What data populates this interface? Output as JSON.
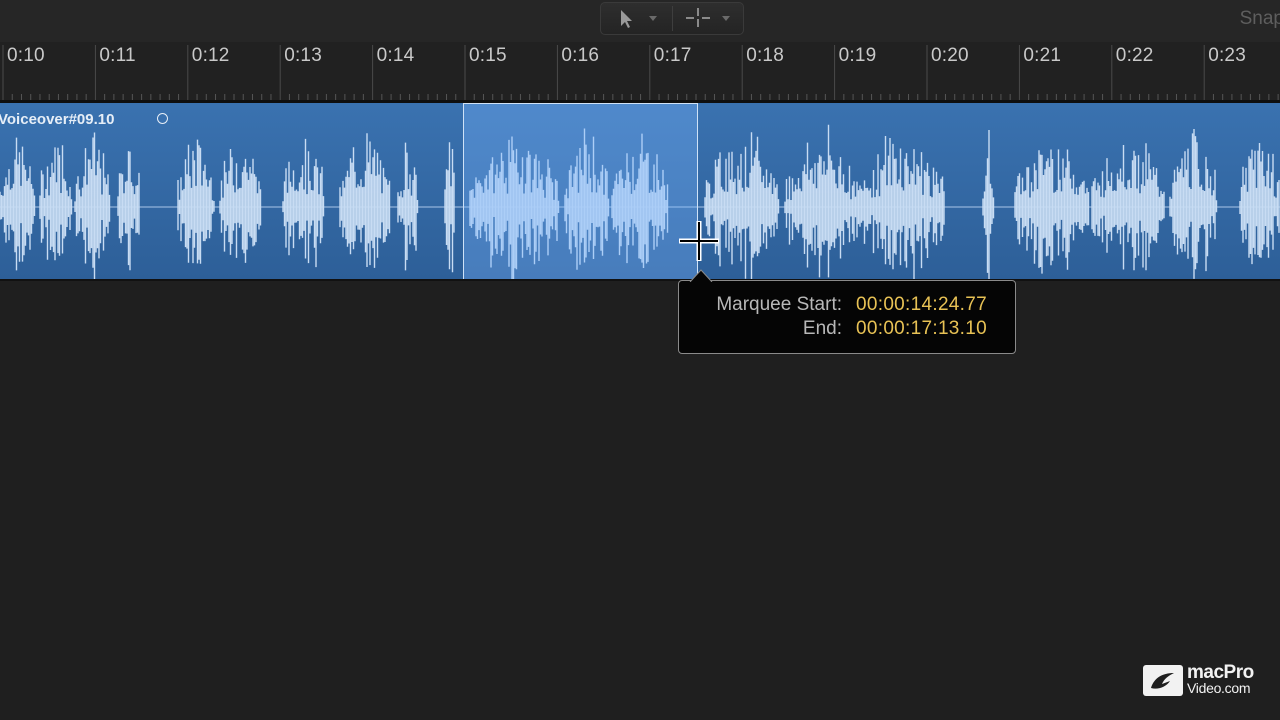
{
  "toolbar": {
    "pointer_tool_icon": "arrow-pointer-icon",
    "marquee_tool_icon": "crosshair-icon",
    "dropdown_icon": "triangle-down-icon",
    "snap_label": "Snap"
  },
  "ruler": {
    "labels": [
      "0:10",
      "0:11",
      "0:12",
      "0:13",
      "0:14",
      "0:15",
      "0:16",
      "0:17",
      "0:18",
      "0:19",
      "0:20",
      "0:21",
      "0:22",
      "0:23"
    ]
  },
  "region": {
    "name": "Voiceover#09.10",
    "loop_icon": "circle-icon",
    "color": "#3a72b0"
  },
  "tooltip": {
    "start_label": "Marquee Start:",
    "start_value": "00:00:14:24.77",
    "end_label": "End:",
    "end_value": "00:00:17:13.10",
    "value_color": "#e8c255"
  },
  "watermark": {
    "line1": "macPro",
    "line2": "Video.com"
  }
}
